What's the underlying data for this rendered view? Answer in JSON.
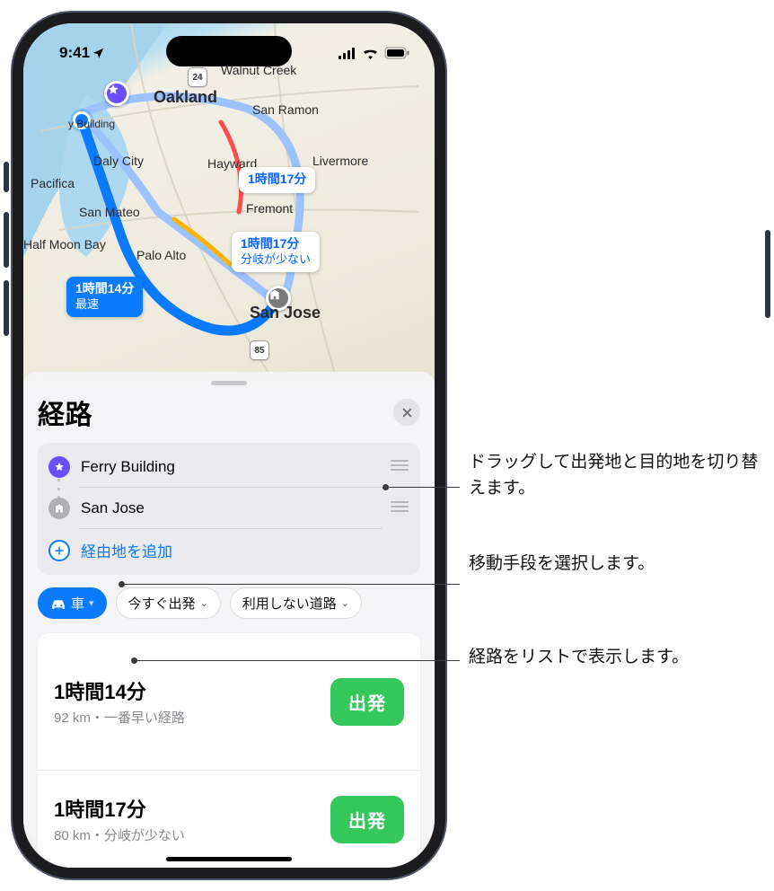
{
  "statusbar": {
    "time": "9:41"
  },
  "map": {
    "cities": {
      "oakland": "Oakland",
      "walnutcreek": "Walnut Creek",
      "sanramon": "San Ramon",
      "hayward": "Hayward",
      "livermore": "Livermore",
      "fremont": "Fremont",
      "pacifica": "Pacifica",
      "dalycity": "Daly City",
      "sanmateo": "San Mateo",
      "halfmoon": "Half Moon Bay",
      "paloalto": "Palo Alto",
      "sanjose": "San Jose",
      "ferry": "y Building"
    },
    "shields": {
      "a": "24",
      "b": "85"
    },
    "callouts": {
      "c1": {
        "t1": "1時間17分"
      },
      "c2": {
        "t1": "1時間17分",
        "t2": "分岐が少ない"
      },
      "c3": {
        "t1": "1時間14分",
        "t2": "最速"
      }
    }
  },
  "sheet": {
    "title": "経路",
    "waypoints": {
      "start": "Ferry Building",
      "end": "San Jose",
      "add": "経由地を追加"
    },
    "chips": {
      "mode": "車",
      "when": "今すぐ出発",
      "avoid": "利用しない道路"
    },
    "routes": [
      {
        "time": "1時間14分",
        "meta": "92 km・一番早い経路",
        "go": "出発"
      },
      {
        "time": "1時間17分",
        "meta": "80 km・分岐が少ない",
        "go": "出発"
      }
    ]
  },
  "annotations": {
    "a1": "ドラッグして出発地と目的地を切り替えます。",
    "a2": "移動手段を選択します。",
    "a3": "経路をリストで表示します。"
  }
}
